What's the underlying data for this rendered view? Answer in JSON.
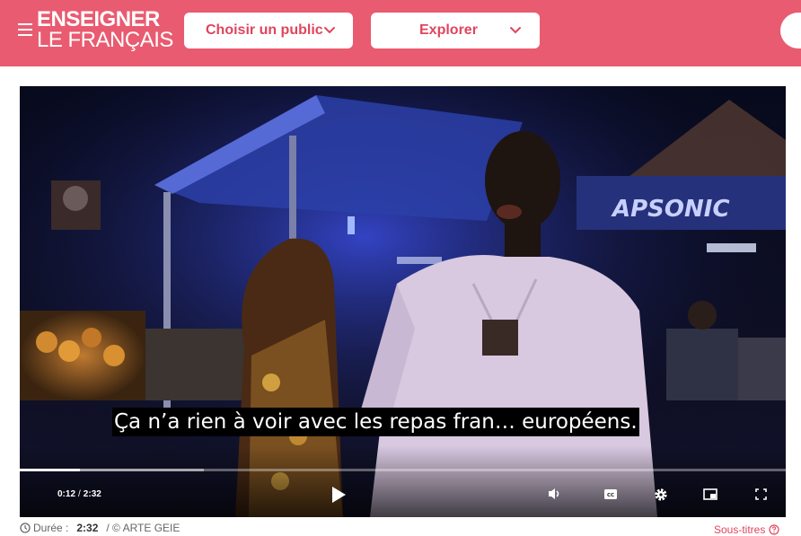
{
  "header": {
    "logo_line1": "ENSEIGNER",
    "logo_line2": "LE FRANÇAIS",
    "nav": [
      {
        "label": "Choisir un public"
      },
      {
        "label": "Explorer"
      }
    ],
    "colors": {
      "brand": "#e95b70",
      "accent_text": "#e0455c"
    }
  },
  "video": {
    "subtitle": "Ça n’a rien à voir avec les repas fran… européens.",
    "scene_sign": "APSONIC",
    "current_time": "0:12",
    "duration": "2:32",
    "progress_fraction": 0.079,
    "buffered_fraction": 0.24,
    "controls": [
      "play-icon",
      "volume-icon",
      "captions-icon",
      "settings-icon",
      "pip-icon",
      "fullscreen-icon"
    ],
    "cc_label": "CC"
  },
  "meta": {
    "duration_label": "Durée :",
    "duration_value": "2:32",
    "credit": "/ © ARTE GEIE",
    "subtitles_link": "Sous-titres"
  }
}
